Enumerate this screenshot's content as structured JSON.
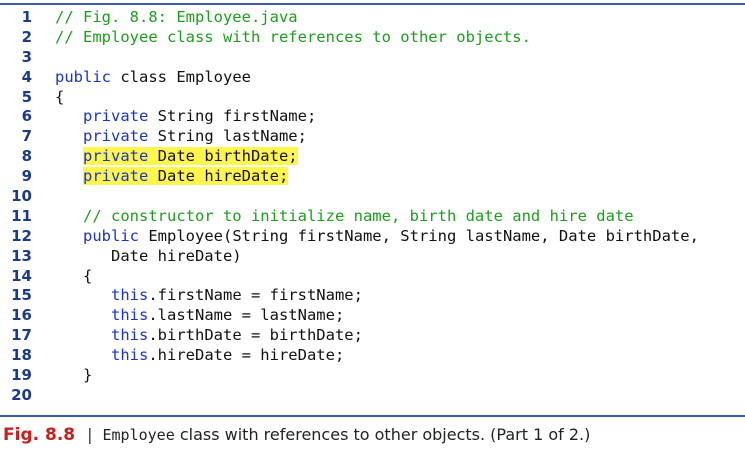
{
  "code_lines": [
    {
      "number": "1",
      "parts": [
        {
          "text": "// Fig. 8.8: Employee.java",
          "style": "comment"
        }
      ]
    },
    {
      "number": "2",
      "parts": [
        {
          "text": "// Employee class with references to other objects.",
          "style": "comment"
        }
      ]
    },
    {
      "number": "3",
      "parts": []
    },
    {
      "number": "4",
      "parts": [
        {
          "text": "public",
          "style": "keyword"
        },
        {
          "text": " class Employee",
          "style": "plain"
        }
      ]
    },
    {
      "number": "5",
      "parts": [
        {
          "text": "{",
          "style": "plain"
        }
      ]
    },
    {
      "number": "6",
      "parts": [
        {
          "text": "   ",
          "style": "plain"
        },
        {
          "text": "private",
          "style": "keyword"
        },
        {
          "text": " String firstName;",
          "style": "plain"
        }
      ]
    },
    {
      "number": "7",
      "parts": [
        {
          "text": "   ",
          "style": "plain"
        },
        {
          "text": "private",
          "style": "keyword"
        },
        {
          "text": " String lastName;",
          "style": "plain"
        }
      ]
    },
    {
      "number": "8",
      "parts": [
        {
          "text": "   ",
          "style": "plain"
        },
        {
          "text": "private",
          "style": "keyword",
          "highlight": true
        },
        {
          "text": " Date birthDate;",
          "style": "plain",
          "highlight": true
        }
      ]
    },
    {
      "number": "9",
      "parts": [
        {
          "text": "   ",
          "style": "plain"
        },
        {
          "text": "private",
          "style": "keyword",
          "highlight": true
        },
        {
          "text": " Date hireDate;",
          "style": "plain",
          "highlight": true
        }
      ]
    },
    {
      "number": "10",
      "parts": []
    },
    {
      "number": "11",
      "parts": [
        {
          "text": "   ",
          "style": "plain"
        },
        {
          "text": "// constructor to initialize name, birth date and hire date",
          "style": "comment"
        }
      ]
    },
    {
      "number": "12",
      "parts": [
        {
          "text": "   ",
          "style": "plain"
        },
        {
          "text": "public",
          "style": "keyword"
        },
        {
          "text": " Employee(String firstName, String lastName, Date birthDate,",
          "style": "plain"
        }
      ]
    },
    {
      "number": "13",
      "parts": [
        {
          "text": "      Date hireDate)",
          "style": "plain"
        }
      ]
    },
    {
      "number": "14",
      "parts": [
        {
          "text": "   {",
          "style": "plain"
        }
      ]
    },
    {
      "number": "15",
      "parts": [
        {
          "text": "      ",
          "style": "plain"
        },
        {
          "text": "this",
          "style": "keyword"
        },
        {
          "text": ".firstName = firstName;",
          "style": "plain"
        }
      ]
    },
    {
      "number": "16",
      "parts": [
        {
          "text": "      ",
          "style": "plain"
        },
        {
          "text": "this",
          "style": "keyword"
        },
        {
          "text": ".lastName = lastName;",
          "style": "plain"
        }
      ]
    },
    {
      "number": "17",
      "parts": [
        {
          "text": "      ",
          "style": "plain"
        },
        {
          "text": "this",
          "style": "keyword"
        },
        {
          "text": ".birthDate = birthDate;",
          "style": "plain"
        }
      ]
    },
    {
      "number": "18",
      "parts": [
        {
          "text": "      ",
          "style": "plain"
        },
        {
          "text": "this",
          "style": "keyword"
        },
        {
          "text": ".hireDate = hireDate;",
          "style": "plain"
        }
      ]
    },
    {
      "number": "19",
      "parts": [
        {
          "text": "   }",
          "style": "plain"
        }
      ]
    },
    {
      "number": "20",
      "parts": []
    }
  ],
  "caption": {
    "figure_label": "Fig. 8.8",
    "separator": "|",
    "class_name": "Employee",
    "text": " class with references to other objects. (Part 1 of 2.)"
  },
  "colors": {
    "keyword": "#1a33c9",
    "comment": "#1c9e1c",
    "highlight": "#fff64d",
    "line_number": "#1a3a8c",
    "figure_label": "#c8201c",
    "rule": "#3a5ba8"
  }
}
